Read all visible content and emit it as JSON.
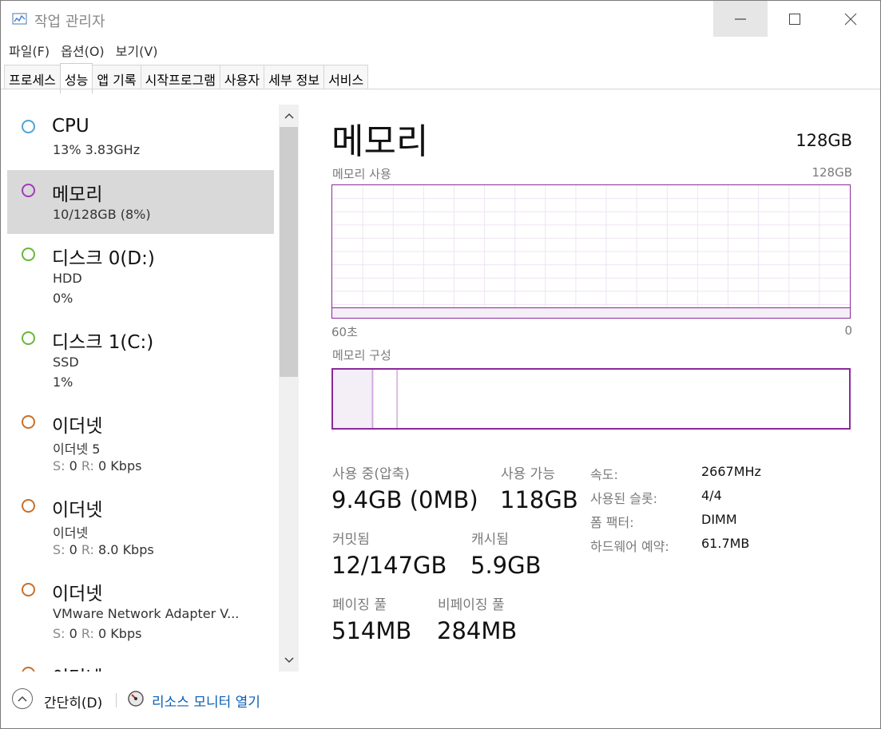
{
  "window": {
    "title": "작업 관리자",
    "app_icon": "task-manager-icon"
  },
  "menu": [
    "파일(F)",
    "옵션(O)",
    "보기(V)"
  ],
  "tabs": [
    {
      "label": "프로세스",
      "active": false
    },
    {
      "label": "성능",
      "active": true
    },
    {
      "label": "앱 기록",
      "active": false
    },
    {
      "label": "시작프로그램",
      "active": false
    },
    {
      "label": "사용자",
      "active": false
    },
    {
      "label": "세부 정보",
      "active": false
    },
    {
      "label": "서비스",
      "active": false
    }
  ],
  "sidebar": {
    "items": [
      {
        "name": "CPU",
        "line1": "13%  3.83GHz",
        "line2": "",
        "color": "#4fa3d8",
        "selected": false
      },
      {
        "name": "메모리",
        "line1": "10/128GB (8%)",
        "line2": "",
        "color": "#a03cb8",
        "selected": true
      },
      {
        "name": "디스크 0(D:)",
        "line1": "HDD",
        "line2": "0%",
        "color": "#6ab63a",
        "selected": false
      },
      {
        "name": "디스크 1(C:)",
        "line1": "SSD",
        "line2": "1%",
        "color": "#6ab63a",
        "selected": false
      },
      {
        "name": "이더넷",
        "line1": "이더넷 5",
        "s_label": "S:",
        "s_val": "0",
        "r_label": "R:",
        "r_val": "0 Kbps",
        "color": "#c8702a",
        "selected": false
      },
      {
        "name": "이더넷",
        "line1": "이더넷",
        "s_label": "S:",
        "s_val": "0",
        "r_label": "R:",
        "r_val": "8.0 Kbps",
        "color": "#c8702a",
        "selected": false
      },
      {
        "name": "이더넷",
        "line1": "VMware Network Adapter V...",
        "s_label": "S:",
        "s_val": "0",
        "r_label": "R:",
        "r_val": "0 Kbps",
        "color": "#c8702a",
        "selected": false
      },
      {
        "name": "이더넷",
        "line1": "",
        "line2": "",
        "color": "#c8702a",
        "selected": false
      }
    ]
  },
  "main": {
    "heading": "메모리",
    "total": "128GB",
    "usage_caption": "메모리 사용",
    "usage_max": "128GB",
    "axis_left": "60초",
    "axis_right": "0",
    "composition_caption": "메모리 구성",
    "usage_fraction": 0.075,
    "composition": {
      "in_use_fraction": 0.075,
      "modified_fraction": 0.003,
      "standby_fraction": 0.046
    },
    "stats": {
      "in_use_label": "사용 중(압축)",
      "in_use_value": "9.4GB (0MB)",
      "available_label": "사용 가능",
      "available_value": "118GB",
      "committed_label": "커밋됨",
      "committed_value": "12/147GB",
      "cached_label": "캐시됨",
      "cached_value": "5.9GB",
      "paged_label": "페이징 풀",
      "paged_value": "514MB",
      "nonpaged_label": "비페이징 풀",
      "nonpaged_value": "284MB"
    },
    "details": [
      {
        "label": "속도:",
        "value": "2667MHz"
      },
      {
        "label": "사용된 슬롯:",
        "value": "4/4"
      },
      {
        "label": "폼 팩터:",
        "value": "DIMM"
      },
      {
        "label": "하드웨어 예약:",
        "value": "61.7MB"
      }
    ]
  },
  "footer": {
    "fewer_details": "간단히(D)",
    "resource_monitor": "리소스 모니터 열기"
  },
  "colors": {
    "memory_accent": "#8b2a9a",
    "link": "#0a5fb4",
    "selected_bg": "#d9d9d9"
  }
}
